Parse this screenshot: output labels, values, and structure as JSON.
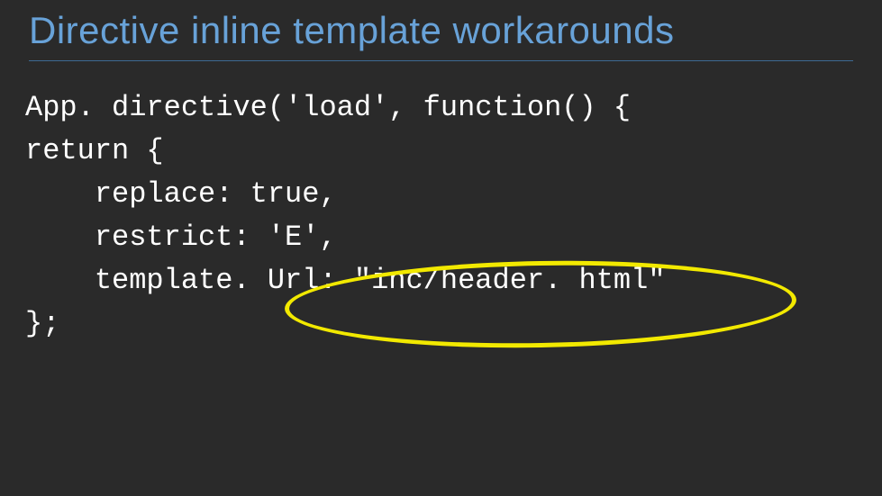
{
  "slide": {
    "title": "Directive inline template workarounds",
    "code": {
      "line1": "App. directive('load', function() {",
      "line2": "return {",
      "line3": "    replace: true,",
      "line4": "    restrict: 'E',",
      "line5": "    template. Url: \"inc/header. html\"",
      "line6": "};"
    },
    "annotation": {
      "shape": "ellipse",
      "color": "#f2e900",
      "highlights": "inc/header. html"
    }
  }
}
